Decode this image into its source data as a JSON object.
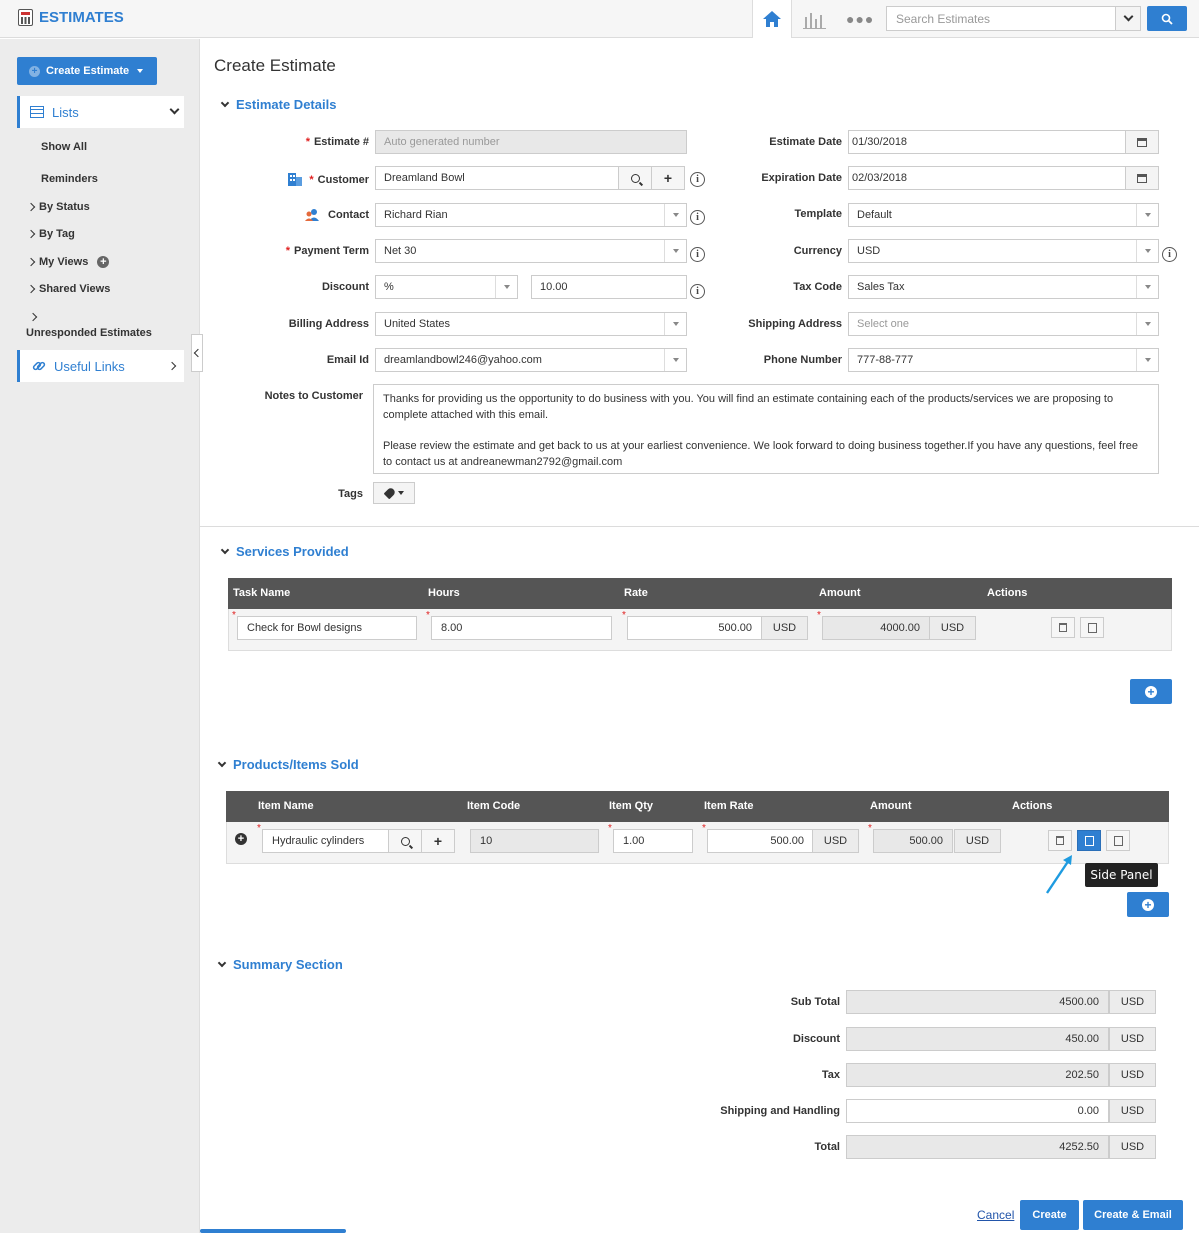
{
  "header": {
    "app_title": "ESTIMATES",
    "search_placeholder": "Search Estimates"
  },
  "sidebar": {
    "create_label": "Create Estimate",
    "lists_label": "Lists",
    "sub_items": [
      "Show All",
      "Reminders"
    ],
    "expandable": [
      "By Status",
      "By Tag",
      "My Views",
      "Shared Views",
      "Unresponded Estimates"
    ],
    "useful_links": "Useful Links"
  },
  "page_title": "Create Estimate",
  "details": {
    "section_title": "Estimate Details",
    "estimate_no": {
      "label": "Estimate #",
      "placeholder": "Auto generated number"
    },
    "customer": {
      "label": "Customer",
      "value": "Dreamland Bowl"
    },
    "contact": {
      "label": "Contact",
      "value": "Richard Rian"
    },
    "payment_term": {
      "label": "Payment Term",
      "value": "Net 30"
    },
    "discount": {
      "label": "Discount",
      "type": "%",
      "value": "10.00"
    },
    "billing_address": {
      "label": "Billing Address",
      "value": "United States"
    },
    "email": {
      "label": "Email Id",
      "value": "dreamlandbowl246@yahoo.com"
    },
    "estimate_date": {
      "label": "Estimate Date",
      "value": "01/30/2018"
    },
    "expiration_date": {
      "label": "Expiration Date",
      "value": "02/03/2018"
    },
    "template": {
      "label": "Template",
      "value": "Default"
    },
    "currency": {
      "label": "Currency",
      "value": "USD"
    },
    "tax_code": {
      "label": "Tax Code",
      "value": "Sales Tax"
    },
    "shipping_address": {
      "label": "Shipping Address",
      "placeholder": "Select one"
    },
    "phone": {
      "label": "Phone Number",
      "value": "777-88-777"
    },
    "notes": {
      "label": "Notes to Customer",
      "p1": "Thanks for providing us the opportunity to do business with you. You will find an estimate containing each of the products/services we are proposing to complete attached with this email.",
      "p2": "Please review the estimate and get back to us at your earliest convenience. We look forward to doing business together.If you have any questions, feel free to contact us at andreanewman2792@gmail.com"
    },
    "tags_label": "Tags"
  },
  "services": {
    "section_title": "Services Provided",
    "columns": [
      "Task Name",
      "Hours",
      "Rate",
      "Amount",
      "Actions"
    ],
    "row": {
      "task": "Check for Bowl designs",
      "hours": "8.00",
      "rate": "500.00",
      "rate_unit": "USD",
      "amount": "4000.00",
      "amount_unit": "USD"
    }
  },
  "products": {
    "section_title": "Products/Items Sold",
    "columns": [
      "Item Name",
      "Item Code",
      "Item Qty",
      "Item Rate",
      "Amount",
      "Actions"
    ],
    "row": {
      "name": "Hydraulic cylinders",
      "code": "10",
      "qty": "1.00",
      "rate": "500.00",
      "rate_unit": "USD",
      "amount": "500.00",
      "amount_unit": "USD"
    },
    "tooltip": "Side Panel"
  },
  "summary": {
    "section_title": "Summary Section",
    "rows": [
      {
        "label": "Sub Total",
        "value": "4500.00",
        "unit": "USD"
      },
      {
        "label": "Discount",
        "value": "450.00",
        "unit": "USD"
      },
      {
        "label": "Tax",
        "value": "202.50",
        "unit": "USD"
      },
      {
        "label": "Shipping and Handling",
        "value": "0.00",
        "unit": "USD"
      },
      {
        "label": "Total",
        "value": "4252.50",
        "unit": "USD"
      }
    ]
  },
  "footer": {
    "cancel": "Cancel",
    "create": "Create",
    "create_email": "Create & Email"
  },
  "colors": {
    "accent": "#2f7fd1",
    "header_row": "#555555"
  }
}
